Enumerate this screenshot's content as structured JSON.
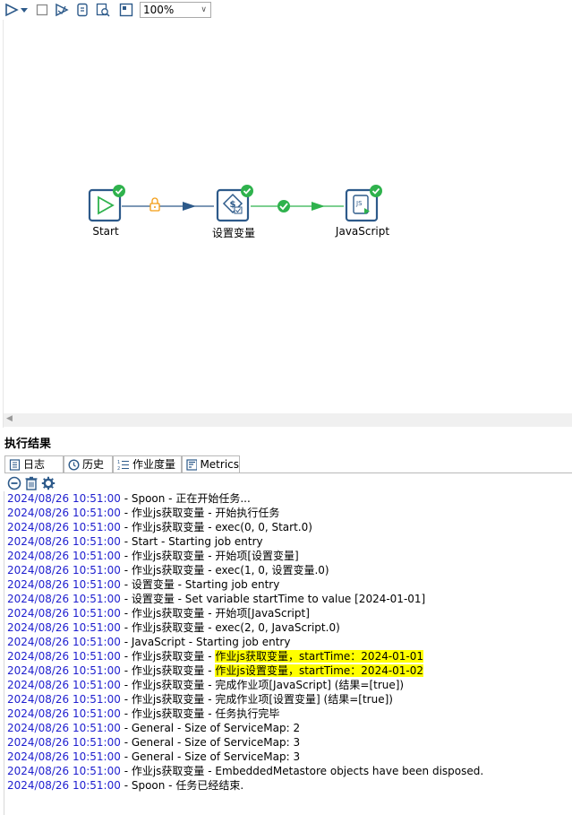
{
  "toolbar": {
    "zoom": "100%",
    "buttons": [
      "run-icon",
      "run-dropdown-icon",
      "stop-icon",
      "preview-icon",
      "debug-icon",
      "replay-icon",
      "sql-icon",
      "explore-icon"
    ]
  },
  "canvas": {
    "nodes": [
      {
        "label": "Start",
        "icon": "start-icon",
        "status": "success"
      },
      {
        "label": "设置变量",
        "icon": "set-variables-icon",
        "status": "success"
      },
      {
        "label": "JavaScript",
        "icon": "javascript-icon",
        "status": "success"
      }
    ],
    "hops": [
      {
        "from": "Start",
        "to": "设置变量",
        "type": "unconditional",
        "icon": "lock-icon",
        "color": "#F39C12"
      },
      {
        "from": "设置变量",
        "to": "JavaScript",
        "type": "success",
        "icon": "check-icon",
        "color": "#2FB24D"
      }
    ]
  },
  "results": {
    "title": "执行结果",
    "tabs": [
      {
        "label": "日志",
        "icon": "log-icon"
      },
      {
        "label": "历史",
        "icon": "history-icon"
      },
      {
        "label": "作业度量",
        "icon": "metrics-list-icon"
      },
      {
        "label": "Metrics",
        "icon": "chart-icon"
      }
    ],
    "tools": [
      "clear-log-icon",
      "delete-icon",
      "settings-icon"
    ]
  },
  "log": [
    {
      "ts": "2024/08/26 10:51:00",
      "pre": " - Spoon - 正在开始任务...",
      "hl": "",
      "post": ""
    },
    {
      "ts": "2024/08/26 10:51:00",
      "pre": " - 作业js获取变量 - 开始执行任务",
      "hl": "",
      "post": ""
    },
    {
      "ts": "2024/08/26 10:51:00",
      "pre": " - 作业js获取变量 - exec(0, 0, Start.0)",
      "hl": "",
      "post": ""
    },
    {
      "ts": "2024/08/26 10:51:00",
      "pre": " - Start - Starting job entry",
      "hl": "",
      "post": ""
    },
    {
      "ts": "2024/08/26 10:51:00",
      "pre": " - 作业js获取变量 - 开始项[设置变量]",
      "hl": "",
      "post": ""
    },
    {
      "ts": "2024/08/26 10:51:00",
      "pre": " - 作业js获取变量 - exec(1, 0, 设置变量.0)",
      "hl": "",
      "post": ""
    },
    {
      "ts": "2024/08/26 10:51:00",
      "pre": " - 设置变量 - Starting job entry",
      "hl": "",
      "post": ""
    },
    {
      "ts": "2024/08/26 10:51:00",
      "pre": " - 设置变量 - Set variable startTime to value [2024-01-01]",
      "hl": "",
      "post": ""
    },
    {
      "ts": "2024/08/26 10:51:00",
      "pre": " - 作业js获取变量 - 开始项[JavaScript]",
      "hl": "",
      "post": ""
    },
    {
      "ts": "2024/08/26 10:51:00",
      "pre": " - 作业js获取变量 - exec(2, 0, JavaScript.0)",
      "hl": "",
      "post": ""
    },
    {
      "ts": "2024/08/26 10:51:00",
      "pre": " - JavaScript - Starting job entry",
      "hl": "",
      "post": ""
    },
    {
      "ts": "2024/08/26 10:51:00",
      "pre": " - 作业js获取变量 - ",
      "hl": "作业js获取变量，startTime：2024-01-01",
      "post": ""
    },
    {
      "ts": "2024/08/26 10:51:00",
      "pre": " - 作业js获取变量 - ",
      "hl": "作业js设置变量，startTime：2024-01-02",
      "post": ""
    },
    {
      "ts": "2024/08/26 10:51:00",
      "pre": " - 作业js获取变量 - 完成作业项[JavaScript] (结果=[true])",
      "hl": "",
      "post": ""
    },
    {
      "ts": "2024/08/26 10:51:00",
      "pre": " - 作业js获取变量 - 完成作业项[设置变量] (结果=[true])",
      "hl": "",
      "post": ""
    },
    {
      "ts": "2024/08/26 10:51:00",
      "pre": " - 作业js获取变量 - 任务执行完毕",
      "hl": "",
      "post": ""
    },
    {
      "ts": "2024/08/26 10:51:00",
      "pre": " - General - Size of ServiceMap:  2",
      "hl": "",
      "post": ""
    },
    {
      "ts": "2024/08/26 10:51:00",
      "pre": " - General - Size of ServiceMap:  3",
      "hl": "",
      "post": ""
    },
    {
      "ts": "2024/08/26 10:51:00",
      "pre": " - General - Size of ServiceMap:  3",
      "hl": "",
      "post": ""
    },
    {
      "ts": "2024/08/26 10:51:00",
      "pre": " - 作业js获取变量 - EmbeddedMetastore objects have been disposed.",
      "hl": "",
      "post": ""
    },
    {
      "ts": "2024/08/26 10:51:00",
      "pre": " - Spoon - 任务已经结束.",
      "hl": "",
      "post": ""
    }
  ]
}
